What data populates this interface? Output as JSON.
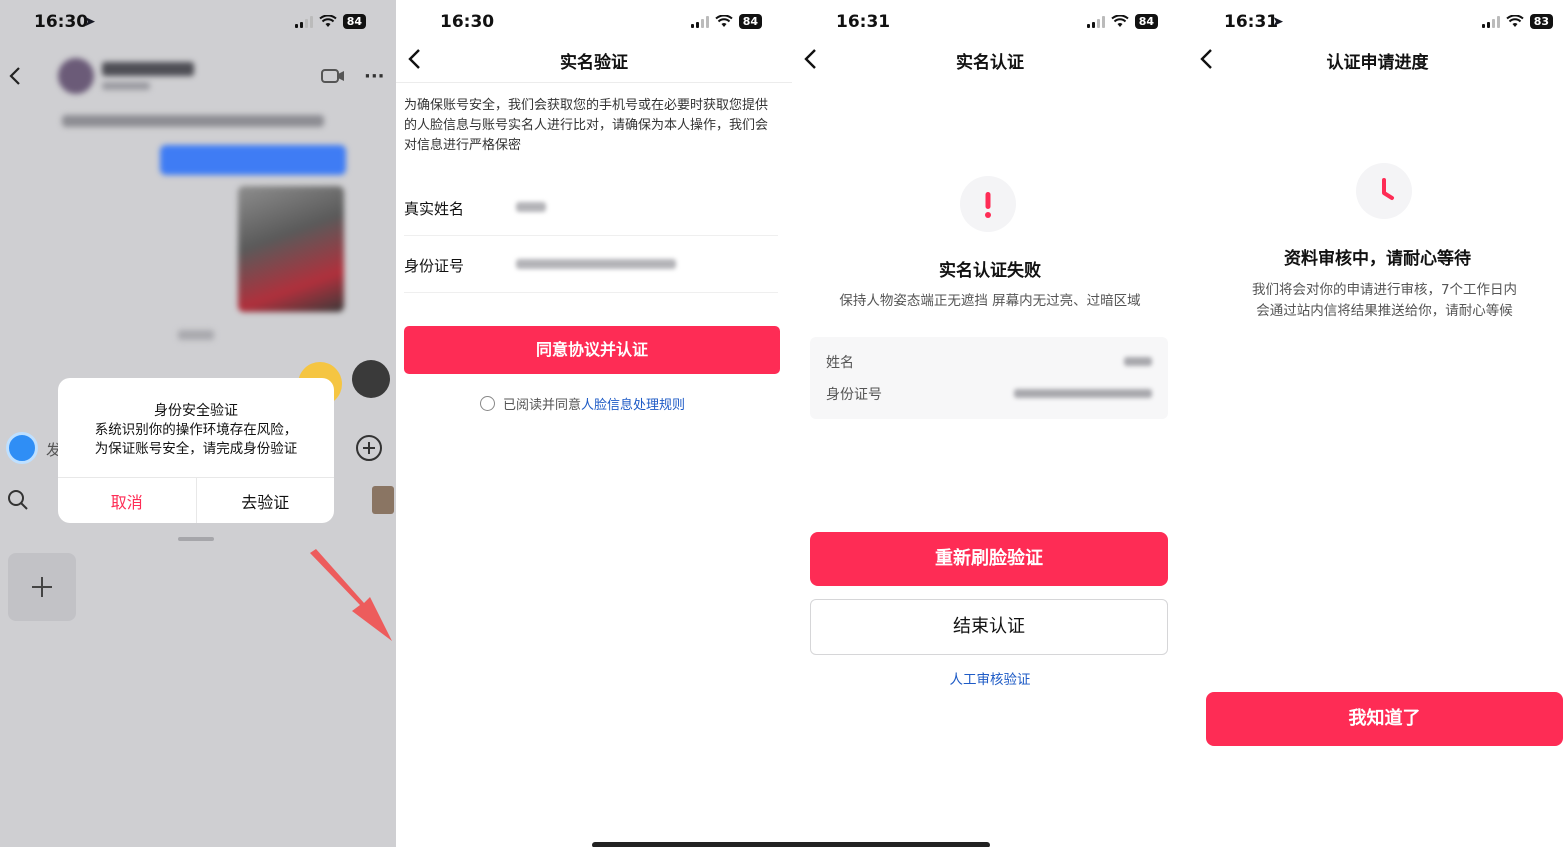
{
  "screen1": {
    "status_time": "16:30",
    "battery": "84",
    "input_placeholder": "发",
    "dialog": {
      "title": "身份安全验证",
      "body_line1": "系统识别你的操作环境存在风险，",
      "body_line2": "为保证账号安全，请完成身份验证",
      "cancel_label": "取消",
      "confirm_label": "去验证"
    },
    "colors": {
      "primary": "#fe2c55",
      "bubble": "#3f7cf4",
      "overlay": "#cfcfd2"
    }
  },
  "screen2": {
    "status_time": "16:30",
    "battery": "84",
    "title": "实名验证",
    "notice": "为确保账号安全，我们会获取您的手机号或在必要时获取您提供的人脸信息与账号实名人进行比对，请确保为本人操作，我们会对信息进行严格保密",
    "name_label": "真实姓名",
    "id_label": "身份证号",
    "submit_label": "同意协议并认证",
    "agree_prefix": "已阅读并同意",
    "agree_link": "人脸信息处理规则"
  },
  "screen3": {
    "status_time": "16:31",
    "battery": "84",
    "title": "实名认证",
    "status_icon": "exclamation-icon",
    "result_title": "实名认证失败",
    "result_desc": "保持人物姿态端正无遮挡 屏幕内无过亮、过暗区域",
    "name_label": "姓名",
    "id_label": "身份证号",
    "retry_label": "重新刷脸验证",
    "end_label": "结束认证",
    "manual_link": "人工审核验证"
  },
  "screen4": {
    "status_time": "16:31",
    "battery": "83",
    "title": "认证申请进度",
    "status_icon": "clock-icon",
    "result_title": "资料审核中，请耐心等待",
    "result_desc": "我们将会对你的申请进行审核，7个工作日内会通过站内信将结果推送给你，请耐心等候",
    "ok_label": "我知道了"
  }
}
